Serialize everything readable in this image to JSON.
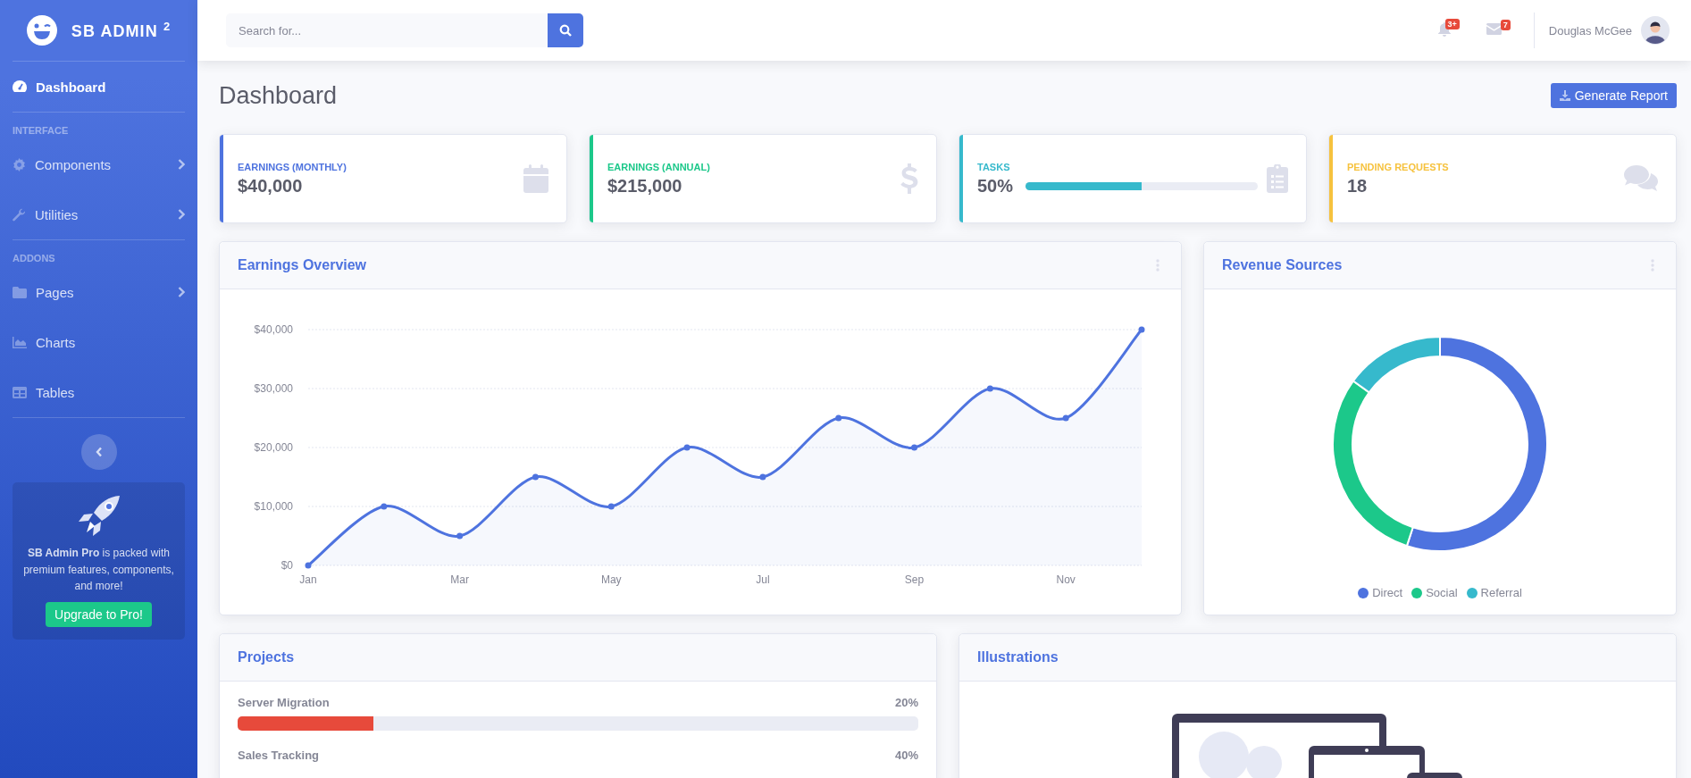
{
  "sidebar": {
    "brand": "SB ADMIN $^{2}$",
    "sections": [
      {
        "items": [
          {
            "label": "Dashboard",
            "selected": true,
            "kind": "dashboard",
            "expandable": false
          }
        ]
      },
      {
        "heading": "INTERFACE",
        "items": [
          {
            "label": "Components",
            "selected": false,
            "kind": "gear",
            "expandable": true
          },
          {
            "label": "Utilities",
            "selected": false,
            "kind": "wrench",
            "expandable": true
          }
        ]
      },
      {
        "heading": "ADDONS",
        "items": [
          {
            "label": "Pages",
            "selected": false,
            "kind": "folder",
            "expandable": true
          },
          {
            "label": "Charts",
            "selected": false,
            "kind": "chart",
            "expandable": false
          },
          {
            "label": "Tables",
            "selected": false,
            "kind": "table",
            "expandable": false
          }
        ]
      }
    ],
    "promo": {
      "text": "**SB Admin Pro** is packed with premium features, components, and more!",
      "button": "Upgrade to Pro!"
    }
  },
  "topbar": {
    "search": {
      "placeholder": "Search for..."
    },
    "alerts_badge": "3+",
    "messages_badge": "7",
    "user_name": "Douglas McGee"
  },
  "page": {
    "title": "Dashboard",
    "button": "Generate Report"
  },
  "stat_cards": [
    {
      "title": "EARNINGS (MONTHLY)",
      "value": "$40,000",
      "color": "#4e73df",
      "kind": "calendar"
    },
    {
      "title": "EARNINGS (ANNUAL)",
      "value": "$215,000",
      "color": "#1cc88a",
      "kind": "dollar"
    },
    {
      "title": "TASKS",
      "value": "50%",
      "color": "#36b9cc",
      "kind": "clipboard",
      "level": 0.5
    },
    {
      "title": "PENDING REQUESTS",
      "value": "18",
      "color": "#f6c23e",
      "kind": "comments"
    }
  ],
  "earnings": {
    "title": "Earnings Overview",
    "chart_data": {
      "type": "area",
      "categories": [
        "Jan",
        null,
        "Mar",
        null,
        "May",
        null,
        "Jul",
        null,
        "Sep",
        null,
        "Nov",
        null
      ],
      "series": [
        {
          "color": "#4e73df",
          "values": [
            0,
            10000,
            5000,
            15000,
            10000,
            20000,
            15000,
            25000,
            20000,
            30000,
            25000,
            40000
          ]
        }
      ],
      "ylim": [
        0,
        40000
      ],
      "grid": true,
      "yticks": [
        {
          "value": 0,
          "label": "$0"
        },
        {
          "value": 10000,
          "label": "$10,000"
        },
        {
          "value": 20000,
          "label": "$20,000"
        },
        {
          "value": 30000,
          "label": "$30,000"
        },
        {
          "value": 40000,
          "label": "$40,000"
        }
      ]
    }
  },
  "revenue": {
    "title": "Revenue Sources",
    "legend": [
      {
        "name": "Direct",
        "color": "#4e73df"
      },
      {
        "name": "Social",
        "color": "#1cc88a"
      },
      {
        "name": "Referral",
        "color": "#36b9cc"
      }
    ]
  },
  "projects": {
    "title": "Projects",
    "items": [
      {
        "name": "Server Migration",
        "percent": "20%",
        "level": 0.2,
        "color": "#e74a3b"
      },
      {
        "name": "Sales Tracking",
        "percent": "40%"
      }
    ]
  },
  "illustrations": {
    "title": "Illustrations"
  }
}
